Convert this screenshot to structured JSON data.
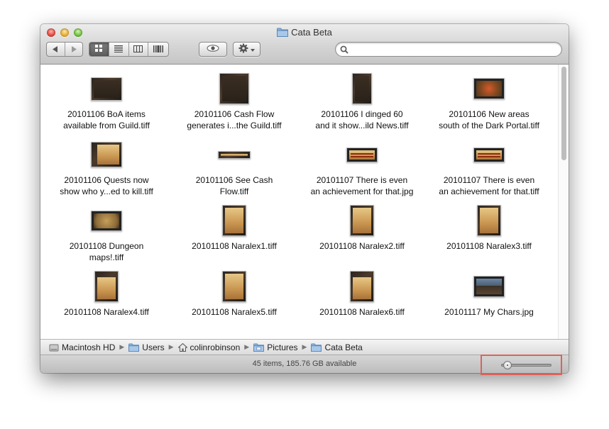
{
  "window": {
    "title": "Cata Beta",
    "title_icon": "folder-icon",
    "traffic_lights": [
      "close",
      "minimize",
      "zoom"
    ]
  },
  "toolbar": {
    "back_icon": "back-arrow-icon",
    "forward_icon": "forward-arrow-icon",
    "views": [
      {
        "name": "icon-view",
        "icon": "grid-icon",
        "active": true
      },
      {
        "name": "list-view",
        "icon": "list-icon",
        "active": false
      },
      {
        "name": "column-view",
        "icon": "columns-icon",
        "active": false
      },
      {
        "name": "coverflow-view",
        "icon": "coverflow-icon",
        "active": false
      }
    ],
    "quicklook_icon": "eye-icon",
    "action_icon": "gear-icon",
    "search": {
      "value": "",
      "placeholder": ""
    }
  },
  "files": [
    {
      "line1": "20101106 BoA items",
      "line2": "available from Guild.tiff",
      "thumb": "dark-ui"
    },
    {
      "line1": "20101106 Cash Flow",
      "line2": "generates i...the Guild.tiff",
      "thumb": "dark-ui-tall"
    },
    {
      "line1": "20101106 I dinged 60",
      "line2": "and it show...ild News.tiff",
      "thumb": "dark-ui-narrow"
    },
    {
      "line1": "20101106 New areas",
      "line2": "south of the Dark Portal.tiff",
      "thumb": "map-red"
    },
    {
      "line1": "20101106 Quests now",
      "line2": "show who y...ed to kill.tiff",
      "thumb": "parchment"
    },
    {
      "line1": "20101106 See Cash",
      "line2": "Flow.tiff",
      "thumb": "bar-thin"
    },
    {
      "line1": "20101107 There is even",
      "line2": "an achievement for that.jpg",
      "thumb": "bar-wide"
    },
    {
      "line1": "20101107 There is even",
      "line2": "an achievement for that.tiff",
      "thumb": "bar-wide"
    },
    {
      "line1": "20101108 Dungeon",
      "line2": "maps!.tiff",
      "thumb": "map-tan"
    },
    {
      "line1": "20101108 Naralex1.tiff",
      "line2": "",
      "thumb": "parchment-tall"
    },
    {
      "line1": "20101108 Naralex2.tiff",
      "line2": "",
      "thumb": "parchment-tall"
    },
    {
      "line1": "20101108 Naralex3.tiff",
      "line2": "",
      "thumb": "parchment-tall"
    },
    {
      "line1": "20101108 Naralex4.tiff",
      "line2": "",
      "thumb": "parchment-tall-dark"
    },
    {
      "line1": "20101108 Naralex5.tiff",
      "line2": "",
      "thumb": "parchment-tall"
    },
    {
      "line1": "20101108 Naralex6.tiff",
      "line2": "",
      "thumb": "parchment-tall-dark"
    },
    {
      "line1": "20101117 My Chars.jpg",
      "line2": "",
      "thumb": "scene"
    }
  ],
  "pathbar": [
    {
      "label": "Macintosh HD",
      "icon": "hard-drive-icon"
    },
    {
      "label": "Users",
      "icon": "folder-icon"
    },
    {
      "label": "colinrobinson",
      "icon": "home-icon"
    },
    {
      "label": "Pictures",
      "icon": "pictures-folder-icon"
    },
    {
      "label": "Cata Beta",
      "icon": "folder-icon"
    }
  ],
  "status": {
    "text": "45 items, 185.76 GB available",
    "icon_size_slider_fraction": 0.05
  },
  "colors": {
    "highlight_border": "#d9645c",
    "active_segment": "#6b6b6b"
  }
}
